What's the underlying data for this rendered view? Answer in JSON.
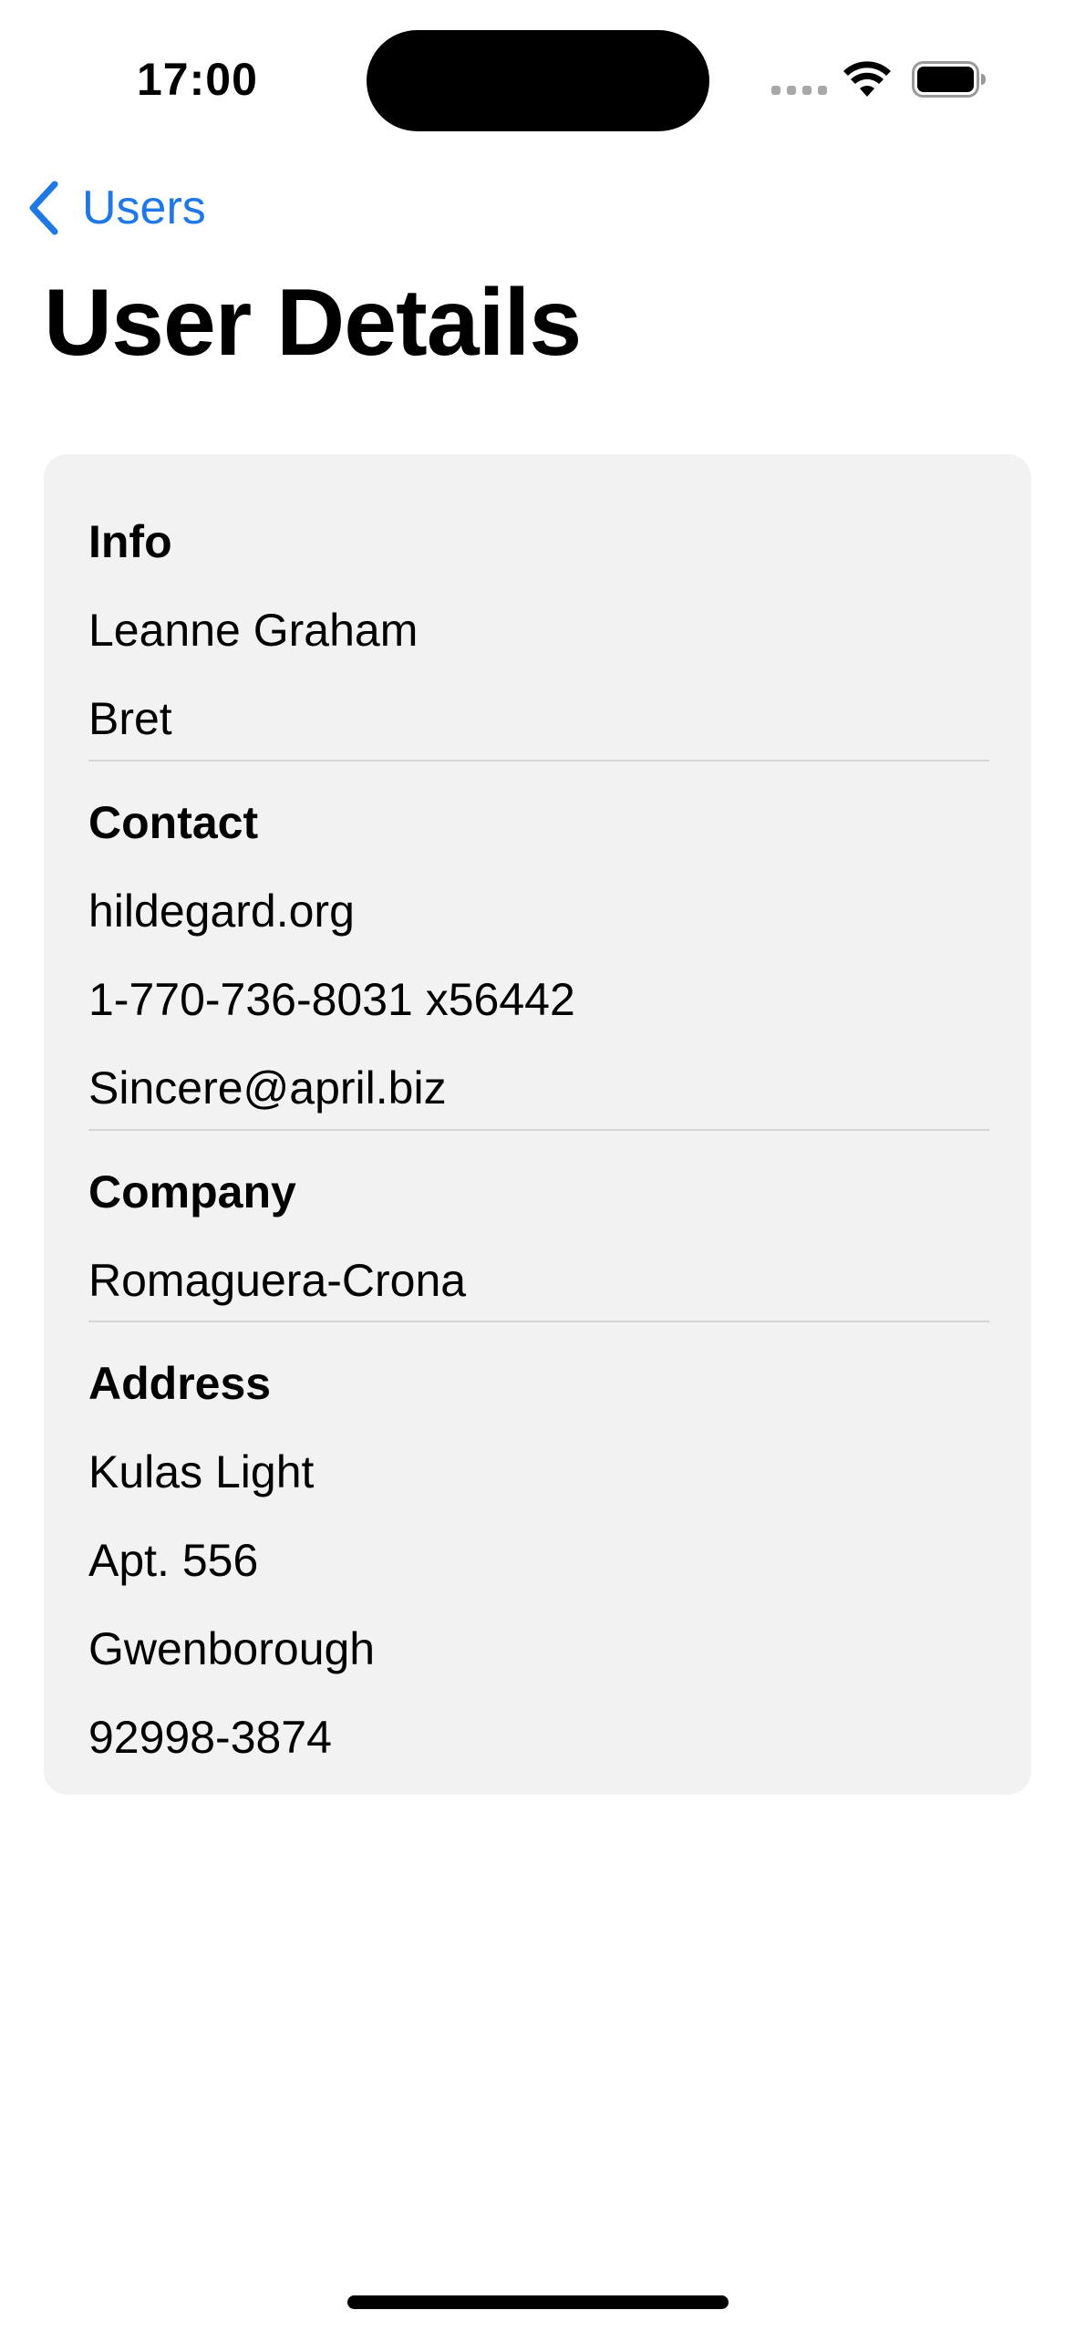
{
  "status_bar": {
    "time": "17:00"
  },
  "nav": {
    "back_label": "Users",
    "title": "User Details"
  },
  "sections": {
    "info": {
      "header": "Info",
      "name": "Leanne Graham",
      "username": "Bret"
    },
    "contact": {
      "header": "Contact",
      "website": "hildegard.org",
      "phone": "1-770-736-8031 x56442",
      "email": "Sincere@april.biz"
    },
    "company": {
      "header": "Company",
      "name": "Romaguera-Crona"
    },
    "address": {
      "header": "Address",
      "street": "Kulas Light",
      "suite": "Apt. 556",
      "city": "Gwenborough",
      "zipcode": "92998-3874"
    }
  },
  "colors": {
    "accent": "#1f78e6",
    "card_background": "#f2f2f2",
    "divider": "#d5d5d5"
  }
}
